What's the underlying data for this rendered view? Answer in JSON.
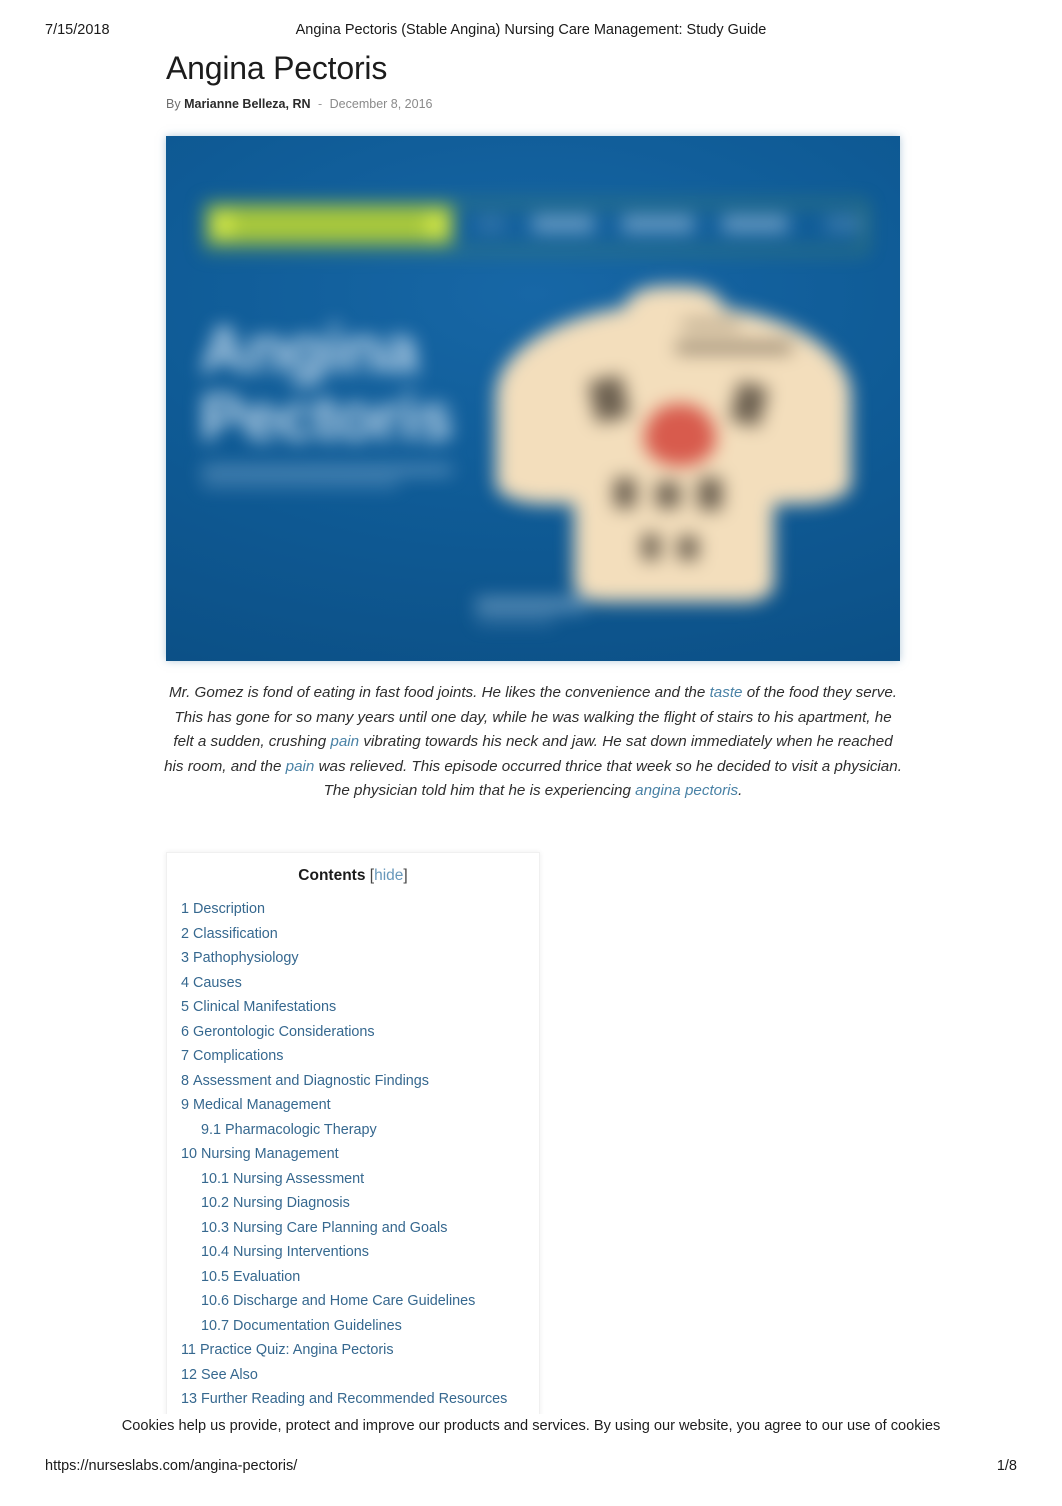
{
  "print_header": {
    "date": "7/15/2018",
    "title": "Angina Pectoris (Stable Angina) Nursing Care Management: Study Guide"
  },
  "article": {
    "title": "Angina Pectoris",
    "byline": {
      "by_word": "By",
      "author": "Marianne Belleza, RN",
      "separator": "-",
      "date": "December 8, 2016"
    },
    "featured_image": {
      "alt": "Angina Pectoris study guide banner",
      "poster_title_line1": "Angina",
      "poster_title_line2": "Pectoris",
      "background_color": "#0f5b96",
      "accent_color": "#a8c83c",
      "heart_color": "#d4493d",
      "skin_color": "#f3debc"
    },
    "intro": {
      "segments": [
        {
          "text": "Mr. Gomez is fond of eating in fast food joints. He likes the convenience and the ",
          "link": false
        },
        {
          "text": "taste",
          "link": true
        },
        {
          "text": " of the food they serve. This has gone for so many years until one day, while he was walking the flight of stairs to his apartment, he felt a sudden, crushing ",
          "link": false
        },
        {
          "text": "pain",
          "link": true
        },
        {
          "text": " vibrating towards his neck and jaw. He sat down immediately when he reached his room, and the ",
          "link": false
        },
        {
          "text": "pain",
          "link": true
        },
        {
          "text": " was relieved. This episode occurred thrice that week so he decided to visit a physician. The physician told him that he is experiencing ",
          "link": false
        },
        {
          "text": "angina pectoris",
          "link": true
        },
        {
          "text": ".",
          "link": false
        }
      ]
    }
  },
  "toc": {
    "title": "Contents",
    "toggle_label": "hide",
    "bracket_open": "[",
    "bracket_close": "]",
    "link_color": "#36688f",
    "items": [
      {
        "num": "1",
        "label": "Description",
        "level": 1
      },
      {
        "num": "2",
        "label": "Classification",
        "level": 1
      },
      {
        "num": "3",
        "label": "Pathophysiology",
        "level": 1
      },
      {
        "num": "4",
        "label": "Causes",
        "level": 1
      },
      {
        "num": "5",
        "label": "Clinical Manifestations",
        "level": 1
      },
      {
        "num": "6",
        "label": "Gerontologic Considerations",
        "level": 1
      },
      {
        "num": "7",
        "label": "Complications",
        "level": 1
      },
      {
        "num": "8",
        "label": "Assessment and Diagnostic Findings",
        "level": 1
      },
      {
        "num": "9",
        "label": "Medical Management",
        "level": 1
      },
      {
        "num": "9.1",
        "label": "Pharmacologic Therapy",
        "level": 2
      },
      {
        "num": "10",
        "label": "Nursing Management",
        "level": 1
      },
      {
        "num": "10.1",
        "label": "Nursing Assessment",
        "level": 2
      },
      {
        "num": "10.2",
        "label": "Nursing Diagnosis",
        "level": 2
      },
      {
        "num": "10.3",
        "label": "Nursing Care Planning and Goals",
        "level": 2
      },
      {
        "num": "10.4",
        "label": "Nursing Interventions",
        "level": 2
      },
      {
        "num": "10.5",
        "label": "Evaluation",
        "level": 2
      },
      {
        "num": "10.6",
        "label": "Discharge and Home Care Guidelines",
        "level": 2
      },
      {
        "num": "10.7",
        "label": "Documentation Guidelines",
        "level": 2
      },
      {
        "num": "11",
        "label": "Practice Quiz: Angina Pectoris",
        "level": 1
      },
      {
        "num": "12",
        "label": "See Also",
        "level": 1
      },
      {
        "num": "13",
        "label": "Further Reading and Recommended Resources",
        "level": 1
      }
    ]
  },
  "cookie_notice": {
    "text": "Cookies help us provide, protect and improve our products and services. By using our website, you agree to our use of cookies"
  },
  "print_footer": {
    "url": "https://nurseslabs.com/angina-pectoris/",
    "page": "1/8"
  }
}
